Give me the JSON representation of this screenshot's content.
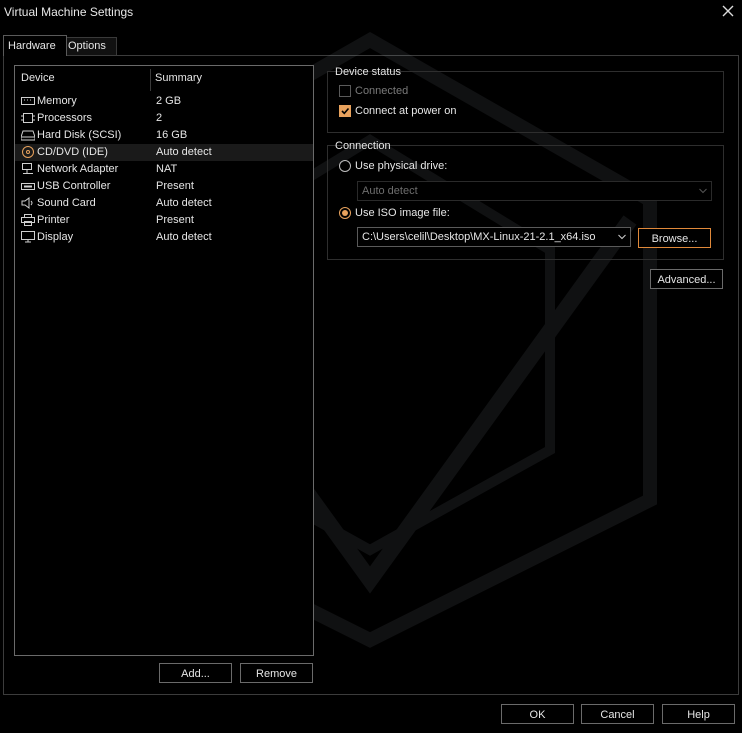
{
  "window": {
    "title": "Virtual Machine Settings"
  },
  "tabs": [
    {
      "label": "Hardware"
    },
    {
      "label": "Options"
    }
  ],
  "device_list": {
    "headers": {
      "device": "Device",
      "summary": "Summary"
    },
    "rows": [
      {
        "icon": "memory-icon",
        "device": "Memory",
        "summary": "2 GB"
      },
      {
        "icon": "processor-icon",
        "device": "Processors",
        "summary": "2"
      },
      {
        "icon": "hard-disk-icon",
        "device": "Hard Disk (SCSI)",
        "summary": "16 GB"
      },
      {
        "icon": "cd-dvd-icon",
        "device": "CD/DVD (IDE)",
        "summary": "Auto detect"
      },
      {
        "icon": "network-adapter-icon",
        "device": "Network Adapter",
        "summary": "NAT"
      },
      {
        "icon": "usb-controller-icon",
        "device": "USB Controller",
        "summary": "Present"
      },
      {
        "icon": "sound-card-icon",
        "device": "Sound Card",
        "summary": "Auto detect"
      },
      {
        "icon": "printer-icon",
        "device": "Printer",
        "summary": "Present"
      },
      {
        "icon": "display-icon",
        "device": "Display",
        "summary": "Auto detect"
      }
    ],
    "selected_index": 3
  },
  "list_buttons": {
    "add": "Add...",
    "remove": "Remove"
  },
  "device_status": {
    "label": "Device status",
    "connected": {
      "label": "Connected",
      "checked": false,
      "enabled": false
    },
    "connect_at_power_on": {
      "label": "Connect at power on",
      "checked": true
    }
  },
  "connection": {
    "label": "Connection",
    "physical": {
      "label": "Use physical drive:",
      "selected": false,
      "value": "Auto detect"
    },
    "iso": {
      "label": "Use ISO image file:",
      "selected": true,
      "value": "C:\\Users\\celil\\Desktop\\MX-Linux-21-2.1_x64.iso"
    },
    "browse": "Browse..."
  },
  "advanced": "Advanced...",
  "footer": {
    "ok": "OK",
    "cancel": "Cancel",
    "help": "Help"
  },
  "colors": {
    "accent": "#e8a25d",
    "background": "#000000",
    "border": "#6a6a6a"
  }
}
